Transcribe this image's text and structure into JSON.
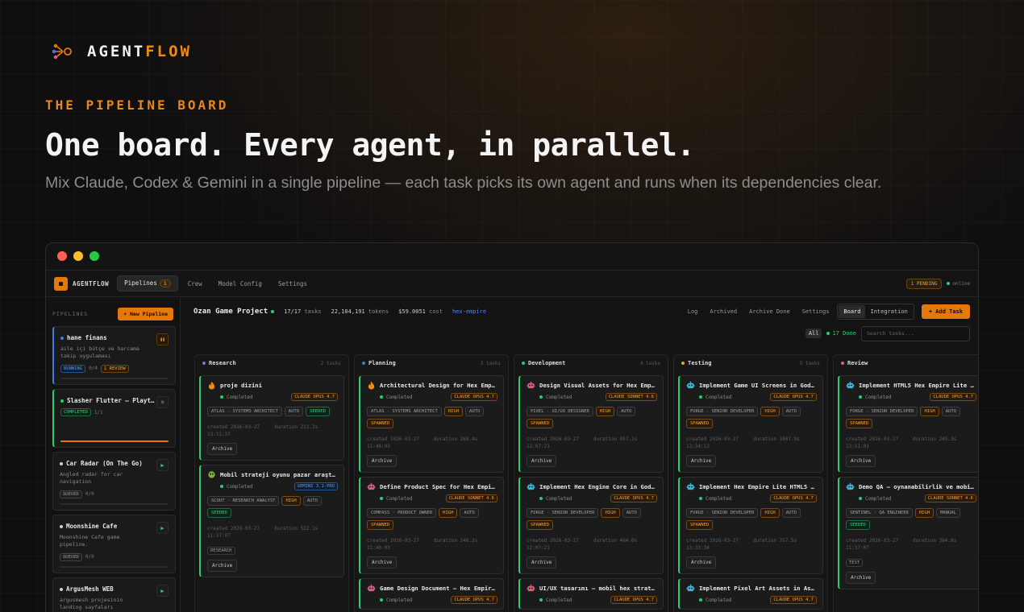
{
  "brand": {
    "name_a": "AGENT",
    "name_b": "FLOW"
  },
  "hero": {
    "eyebrow": "THE PIPELINE BOARD",
    "headline": "One board. Every agent, in parallel.",
    "subline": "Mix Claude, Codex & Gemini in a single pipeline — each task picks its own agent and runs when its dependencies clear."
  },
  "colors": {
    "accent": "#e5780c",
    "success": "#2ecc71",
    "info": "#3d7be5"
  },
  "app": {
    "name": "AGENTFLOW",
    "nav": [
      {
        "label": "Pipelines",
        "count": "1"
      },
      {
        "label": "Crew"
      },
      {
        "label": "Model Config"
      },
      {
        "label": "Settings"
      }
    ],
    "pending": "1 PENDING",
    "online": "online"
  },
  "sidebar": {
    "title": "PIPELINES",
    "new_button": "+ New Pipeline",
    "pipelines": [
      {
        "name": "hane finans",
        "desc": "aile içi bütçe ve harcama takip uygulaması",
        "status": "RUNNING",
        "progress_text": "0/4",
        "extra": "1 REVIEW",
        "progress": 0.0
      },
      {
        "name": "Slasher Flutter — Playt…",
        "desc": "",
        "status": "COMPLETED",
        "progress_text": "1/1",
        "progress": 1.0
      },
      {
        "name": "Car Radar (On The Go)",
        "desc": "Angled radar for car navigation",
        "status": "QUEUED",
        "progress_text": "0/0",
        "progress": 0.0
      },
      {
        "name": "Moonshine Cafe",
        "desc": "Moonshine Cafe game pipeline.",
        "status": "QUEUED",
        "progress_text": "0/0",
        "progress": 0.0
      },
      {
        "name": "ArgusMesh WEB",
        "desc": "argusmesh projesinin landing sayfaları",
        "status": "QUEUED",
        "progress_text": "0/0",
        "progress": 0.0
      }
    ]
  },
  "project": {
    "name": "Ozan Game Project",
    "tasks_value": "17/17",
    "tasks_label": "tasks",
    "tokens_value": "22,104,191",
    "tokens_label": "tokens",
    "cost_value": "$59.0051",
    "cost_label": "cost",
    "tag": "hex-empire",
    "links": [
      "Log",
      "Archived",
      "Archive Done",
      "Settings"
    ],
    "views": [
      "Board",
      "Integration"
    ],
    "add_task": "+ Add Task",
    "filter_all": "All",
    "filter_done": "17 Done",
    "search_placeholder": "Search tasks..."
  },
  "columns": [
    {
      "title": "Research",
      "count": "2 tasks",
      "color": "#8a6cf0",
      "cards": [
        {
          "icon": "flame",
          "title": "proje dizini",
          "status": "Completed",
          "model": "CLAUDE OPUS 4.7",
          "tags": [
            [
              "ATLAS · SYSTEMS ARCHITECT",
              ""
            ],
            [
              "AUTO",
              ""
            ],
            [
              "SEEDED",
              "sd"
            ]
          ],
          "created": "created 2026-03-27\n13:11:37",
          "duration": "duration 213.3s",
          "archive": "Archive"
        },
        {
          "icon": "bulb",
          "title": "Mobil strateji oyunu pazar araştı…",
          "status": "Completed",
          "model": "GEMINI 3.1-PRO",
          "model_kind": "gem",
          "tags": [
            [
              "SCOUT · RESEARCH ANALYST",
              ""
            ],
            [
              "HIGH",
              "hi"
            ],
            [
              "AUTO",
              ""
            ],
            [
              "SEEDED",
              "sd"
            ]
          ],
          "created": "created 2026-03-27\n11:37:07",
          "duration": "duration 522.1s",
          "extra": "RESEARCH",
          "archive": "Archive"
        }
      ]
    },
    {
      "title": "Planning",
      "count": "3 tasks",
      "color": "#3d7be5",
      "cards": [
        {
          "icon": "flame",
          "title": "Architectural Design for Hex Empire…",
          "status": "Completed",
          "model": "CLAUDE OPUS 4.7",
          "tags": [
            [
              "ATLAS · SYSTEMS ARCHITECT",
              ""
            ],
            [
              "HIGH",
              "hi"
            ],
            [
              "AUTO",
              ""
            ],
            [
              "SPAWNED",
              "sp"
            ]
          ],
          "created": "created 2026-03-27\n11:46:03",
          "duration": "duration 268.4s",
          "archive": "Archive"
        },
        {
          "icon": "robot",
          "title": "Define Product Spec for Hex Empire…",
          "status": "Completed",
          "model": "CLAUDE SONNET 4.6",
          "tags": [
            [
              "COMPASS · PRODUCT OWNER",
              ""
            ],
            [
              "HIGH",
              "hi"
            ],
            [
              "AUTO",
              ""
            ],
            [
              "SPAWNED",
              "sp"
            ]
          ],
          "created": "created 2026-03-27\n11:46:03",
          "duration": "duration 140.2s",
          "archive": "Archive"
        },
        {
          "icon": "robot",
          "title": "Game Design Document — Hex Empire…",
          "status": "Completed",
          "model": "CLAUDE OPUS 4.7",
          "tags": [],
          "created": "",
          "duration": "",
          "archive": ""
        }
      ]
    },
    {
      "title": "Development",
      "count": "4 tasks",
      "color": "#2ecc71",
      "cards": [
        {
          "icon": "robot-red",
          "title": "Design Visual Assets for Hex Empi…",
          "status": "Completed",
          "model": "CLAUDE SONNET 4.6",
          "tags": [
            [
              "PIXEL · UI/UX DESIGNER",
              ""
            ],
            [
              "HIGH",
              "hi"
            ],
            [
              "AUTO",
              ""
            ],
            [
              "SPAWNED",
              "sp"
            ]
          ],
          "created": "created 2026-03-27\n12:07:21",
          "duration": "duration 957.1s",
          "archive": "Archive"
        },
        {
          "icon": "robot-teal",
          "title": "Implement Hex Engine Core in Godo…",
          "status": "Completed",
          "model": "CLAUDE OPUS 4.7",
          "tags": [
            [
              "FORGE · SENIOR DEVELOPER",
              ""
            ],
            [
              "HIGH",
              "hi"
            ],
            [
              "AUTO",
              ""
            ],
            [
              "SPAWNED",
              "sp"
            ]
          ],
          "created": "created 2026-03-27\n12:07:21",
          "duration": "duration 464.0s",
          "archive": "Archive"
        },
        {
          "icon": "robot-red",
          "title": "UI/UX tasarımı — mobil hex strate…",
          "status": "Completed",
          "model": "CLAUDE OPUS 4.7",
          "tags": [],
          "created": "",
          "duration": "",
          "archive": ""
        }
      ]
    },
    {
      "title": "Testing",
      "count": "5 tasks",
      "color": "#f0a040",
      "cards": [
        {
          "icon": "robot-teal",
          "title": "Implement Game UI Screens in God…",
          "status": "Completed",
          "model": "CLAUDE OPUS 4.7",
          "tags": [
            [
              "FORGE · SENIOR DEVELOPER",
              ""
            ],
            [
              "HIGH",
              "hi"
            ],
            [
              "AUTO",
              ""
            ],
            [
              "SPAWNED",
              "sp"
            ]
          ],
          "created": "created 2026-03-27\n13:34:13",
          "duration": "duration 1007.9s",
          "archive": "Archive"
        },
        {
          "icon": "robot-teal",
          "title": "Implement Hex Empire Lite HTML5 …",
          "status": "Completed",
          "model": "CLAUDE OPUS 4.7",
          "tags": [
            [
              "FORGE · SENIOR DEVELOPER",
              ""
            ],
            [
              "HIGH",
              "hi"
            ],
            [
              "AUTO",
              ""
            ],
            [
              "SPAWNED",
              "sp"
            ]
          ],
          "created": "created 2026-03-27\n13:33:34",
          "duration": "duration 757.5s",
          "archive": "Archive"
        },
        {
          "icon": "robot-teal",
          "title": "Implement Pixel Art Assets in Ass…",
          "status": "Completed",
          "model": "CLAUDE OPUS 4.7",
          "tags": [],
          "created": "",
          "duration": "",
          "archive": ""
        }
      ]
    },
    {
      "title": "Review",
      "count": "",
      "color": "#e55a8a",
      "cards": [
        {
          "icon": "robot-teal",
          "title": "Implement HTML5 Hex Empire Lite ga…",
          "status": "Completed",
          "model": "CLAUDE OPUS 4.7",
          "tags": [
            [
              "FORGE · SENIOR DEVELOPER",
              ""
            ],
            [
              "HIGH",
              "hi"
            ],
            [
              "AUTO",
              ""
            ],
            [
              "SPAWNED",
              "sp"
            ]
          ],
          "created": "created 2026-03-27\n13:51:01",
          "duration": "duration 245.3s",
          "archive": "Archive"
        },
        {
          "icon": "robot-teal",
          "title": "Demo QA — oynanabilirlik ve mobil…",
          "status": "Completed",
          "model": "CLAUDE SONNET 4.6",
          "tags": [
            [
              "SENTINEL · QA ENGINEER",
              ""
            ],
            [
              "HIGH",
              "hi"
            ],
            [
              "MANUAL",
              ""
            ],
            [
              "SEEDED",
              "sd"
            ]
          ],
          "created": "created 2026-03-27\n11:37:07",
          "duration": "duration 384.8s",
          "extra": "TEST",
          "archive": "Archive"
        }
      ]
    }
  ]
}
